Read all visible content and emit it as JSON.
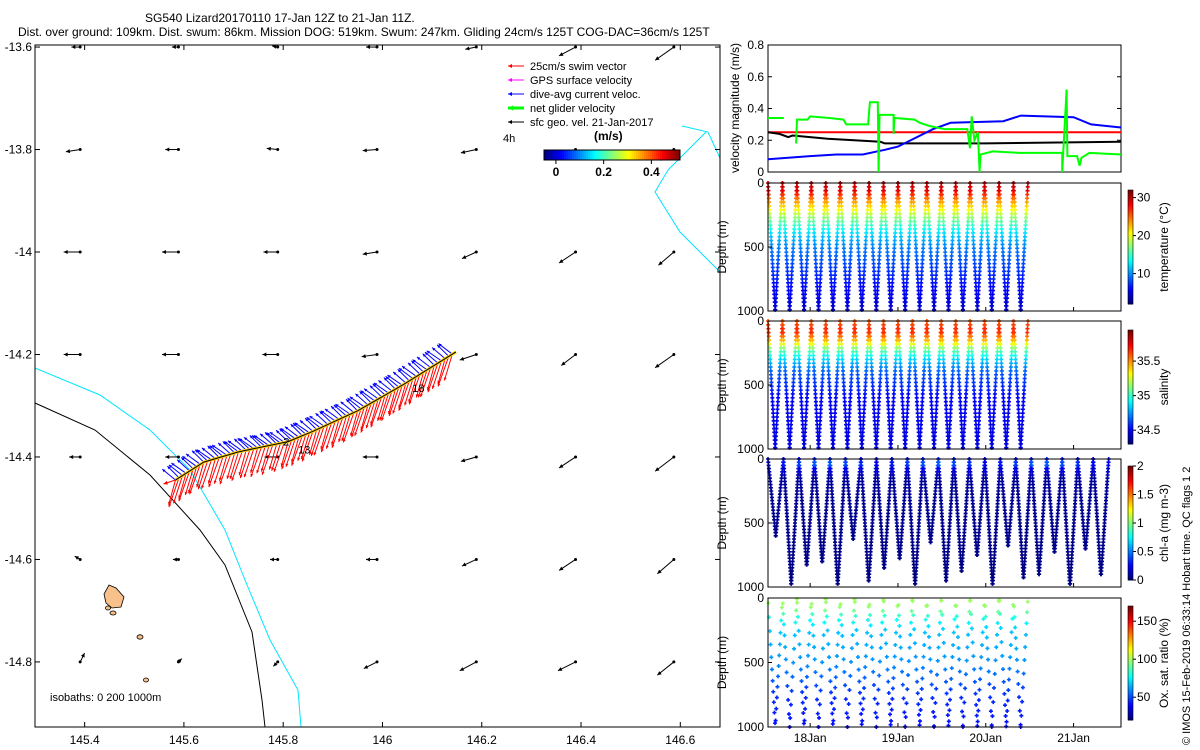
{
  "title": {
    "line1": "SG540 Lizard20170110 17-Jan 12Z to 21-Jan 11Z.",
    "line2": "Dist. over ground: 109km. Dist. swum: 86km. Mission DOG: 519km. Swum: 247km. Gliding 24cm/s 125T COG-DAC=36cm/s 125T"
  },
  "credit": "© IMOS 15-Feb-2019 06:33:14 Hobart time. QC flags 1  2",
  "chart_data": [
    {
      "type": "map",
      "name": "track-map",
      "xlim": [
        145.3,
        146.68
      ],
      "ylim": [
        -14.927,
        -13.596
      ],
      "xticks": [
        145.4,
        145.6,
        145.8,
        146,
        146.2,
        146.4,
        146.6
      ],
      "xtick_labels": [
        "145.4",
        "145.6",
        "145.8",
        "146",
        "146.2",
        "146.4",
        "146.6"
      ],
      "yticks": [
        -13.6,
        -13.8,
        -14,
        -14.2,
        -14.4,
        -14.6,
        -14.8
      ],
      "ytick_labels": [
        "-13.6",
        "-13.8",
        "-14",
        "-14.2",
        "-14.4",
        "-14.6",
        "-14.8"
      ],
      "legend": {
        "placement": "top-right",
        "entries": [
          {
            "label": "25cm/s swim vector",
            "color": "#ff0000"
          },
          {
            "label": "GPS surface velocity",
            "color": "#ff00ff"
          },
          {
            "label": "dive-avg current veloc.",
            "color": "#0000ff"
          },
          {
            "label": "net glider velocity",
            "color": "#00ff00"
          },
          {
            "label": "sfc geo. vel. 21-Jan-2017",
            "color": "#000000"
          }
        ],
        "interval_label": "4h"
      },
      "speed_colorbar": {
        "label": "(m/s)",
        "range": [
          -0.05,
          0.52
        ],
        "ticks": [
          0,
          0.2,
          0.4
        ],
        "tick_labels": [
          "0",
          "0.2",
          "0.4"
        ]
      },
      "isobath_label": "isobaths: 0   200  1000m",
      "vector_field": {
        "lons": [
          145.391,
          145.589,
          145.789,
          145.989,
          146.189,
          146.389,
          146.587
        ],
        "lats": [
          -13.6,
          -13.8,
          -14.0,
          -14.2,
          -14.4,
          -14.6,
          -14.8
        ],
        "uv": [
          [
            [
              -0.08,
              0
            ],
            [
              -0.06,
              0
            ],
            [
              -0.05,
              0.01
            ],
            [
              -0.1,
              0
            ],
            [
              -0.1,
              -0.02
            ],
            [
              -0.15,
              -0.08
            ],
            [
              -0.17,
              -0.12
            ]
          ],
          [
            [
              -0.13,
              -0.02
            ],
            [
              -0.12,
              0
            ],
            [
              -0.1,
              0.01
            ],
            [
              -0.13,
              -0.01
            ],
            [
              -0.14,
              -0.03
            ],
            [
              -0.15,
              -0.06
            ],
            [
              -0.12,
              -0.1
            ]
          ],
          [
            [
              -0.15,
              0
            ],
            [
              -0.15,
              0
            ],
            [
              -0.13,
              0
            ],
            [
              -0.13,
              -0.02
            ],
            [
              -0.13,
              -0.06
            ],
            [
              -0.15,
              -0.1
            ],
            [
              -0.14,
              -0.12
            ]
          ],
          [
            [
              -0.15,
              0
            ],
            [
              -0.15,
              0
            ],
            [
              -0.14,
              0
            ],
            [
              -0.14,
              -0.02
            ],
            [
              -0.15,
              -0.05
            ],
            [
              -0.13,
              -0.1
            ],
            [
              -0.17,
              -0.12
            ]
          ],
          [
            [
              -0.1,
              0
            ],
            [
              -0.12,
              0
            ],
            [
              -0.12,
              0
            ],
            [
              -0.13,
              0
            ],
            [
              -0.14,
              -0.04
            ],
            [
              -0.15,
              -0.1
            ],
            [
              -0.17,
              -0.13
            ]
          ],
          [
            [
              -0.05,
              0.03
            ],
            [
              -0.05,
              0
            ],
            [
              -0.07,
              0
            ],
            [
              -0.1,
              0
            ],
            [
              -0.13,
              -0.06
            ],
            [
              -0.15,
              -0.1
            ],
            [
              -0.15,
              -0.13
            ]
          ],
          [
            [
              0.04,
              0.08
            ],
            [
              0.03,
              0.03
            ],
            [
              -0.04,
              -0.04
            ],
            [
              -0.12,
              -0.06
            ],
            [
              -0.15,
              -0.08
            ],
            [
              -0.16,
              -0.08
            ],
            [
              -0.15,
              -0.12
            ]
          ]
        ]
      },
      "track": [
        [
          145.583,
          -14.445
        ],
        [
          145.64,
          -14.41
        ],
        [
          145.71,
          -14.39
        ],
        [
          145.81,
          -14.37
        ],
        [
          145.86,
          -14.35
        ],
        [
          145.95,
          -14.31
        ],
        [
          146.04,
          -14.26
        ],
        [
          146.09,
          -14.23
        ],
        [
          146.148,
          -14.195
        ]
      ],
      "track_labels": [
        {
          "text": "2",
          "lon": 145.8,
          "lat": -14.37
        },
        {
          "text": "13",
          "lon": 145.83,
          "lat": -14.385
        },
        {
          "text": "18",
          "lon": 146.06,
          "lat": -14.265
        }
      ],
      "current_vector": [
        -0.12,
        0.22
      ],
      "swim_vector": [
        -0.08,
        -0.25
      ]
    },
    {
      "type": "line",
      "name": "velocity-magnitude",
      "ylabel": "velocity magnitude (m/s)",
      "xlim": [
        17.52,
        21.54
      ],
      "ylim": [
        0,
        0.8
      ],
      "yticks": [
        0,
        0.2,
        0.4,
        0.6,
        0.8
      ],
      "ytick_labels": [
        "0",
        "0.2",
        "0.4",
        "0.6",
        "0.8"
      ],
      "series": [
        {
          "name": "swim",
          "color": "#ff0000",
          "x": [
            17.52,
            21.54
          ],
          "y": [
            0.25,
            0.25
          ]
        },
        {
          "name": "sfc geo",
          "color": "#000000",
          "x": [
            17.52,
            17.65,
            17.75,
            17.8,
            18.2,
            18.5,
            18.8,
            18.85,
            19.0,
            19.5,
            20.0,
            21.54
          ],
          "y": [
            0.25,
            0.24,
            0.22,
            0.23,
            0.21,
            0.2,
            0.19,
            0.18,
            0.18,
            0.18,
            0.18,
            0.19
          ]
        },
        {
          "name": "dive-avg current",
          "color": "#0000ff",
          "x": [
            17.52,
            18.0,
            18.3,
            18.6,
            18.85,
            19.0,
            19.4,
            19.6,
            20.2,
            20.4,
            21.0,
            21.2,
            21.54
          ],
          "y": [
            0.08,
            0.1,
            0.11,
            0.11,
            0.14,
            0.16,
            0.27,
            0.31,
            0.32,
            0.355,
            0.345,
            0.3,
            0.28
          ]
        },
        {
          "name": "net glider",
          "color": "#00ff00",
          "x": [
            17.52,
            17.7,
            null,
            17.84,
            17.85,
            17.97,
            18.0,
            18.22,
            18.38,
            18.41,
            18.66,
            18.68,
            18.77,
            18.78,
            18.79,
            18.95,
            18.95,
            18.96,
            19.19,
            19.25,
            19.36,
            19.53,
            19.79,
            19.82,
            19.84,
            19.87,
            19.91,
            19.93,
            19.94,
            20.08,
            20.38,
            20.87,
            20.87,
            20.92,
            20.93,
            21.04,
            21.07,
            21.09,
            21.18,
            21.54
          ],
          "y": [
            0.34,
            0.34,
            null,
            0.18,
            0.33,
            0.33,
            0.35,
            0.34,
            0.33,
            0.3,
            0.3,
            0.44,
            0.44,
            0,
            0.36,
            0.36,
            0.24,
            0.34,
            0.33,
            0.31,
            0.29,
            0.27,
            0.27,
            0.15,
            0.35,
            0.2,
            0.25,
            0,
            0.11,
            0.13,
            0.12,
            0.12,
            0,
            0.52,
            0.1,
            0.1,
            0.04,
            0.09,
            0.12,
            0.11
          ]
        }
      ]
    },
    {
      "type": "scatter",
      "name": "temperature-section",
      "variable": "temperature",
      "ylabel": "Depth (m)",
      "clabel": "temperature (°C)",
      "ylim": [
        1000,
        0
      ],
      "clim": [
        2,
        32
      ],
      "cticks": [
        10,
        20,
        30
      ],
      "ctick_labels": [
        "10",
        "20",
        "30"
      ],
      "dives": {
        "start": 17.52,
        "end": 20.48,
        "count": 18,
        "max_depth": 1000,
        "sample_m": 30
      },
      "profile": [
        [
          0,
          30
        ],
        [
          60,
          29
        ],
        [
          120,
          25
        ],
        [
          200,
          21
        ],
        [
          300,
          16
        ],
        [
          400,
          12
        ],
        [
          500,
          9.5
        ],
        [
          700,
          7
        ],
        [
          1000,
          4
        ]
      ]
    },
    {
      "type": "scatter",
      "name": "salinity-section",
      "variable": "salinity",
      "ylabel": "Depth (m)",
      "clabel": "salinity",
      "ylim": [
        1000,
        0
      ],
      "clim": [
        34.3,
        35.95
      ],
      "cticks": [
        34.5,
        35,
        35.5
      ],
      "ctick_labels": [
        "34.5",
        "35",
        "35.5"
      ],
      "dives": {
        "start": 17.52,
        "end": 20.48,
        "count": 18,
        "max_depth": 1000,
        "sample_m": 30
      },
      "profile": [
        [
          0,
          35.6
        ],
        [
          80,
          35.7
        ],
        [
          150,
          35.45
        ],
        [
          220,
          35.1
        ],
        [
          300,
          34.85
        ],
        [
          400,
          34.65
        ],
        [
          600,
          34.5
        ],
        [
          1000,
          34.45
        ]
      ]
    },
    {
      "type": "scatter",
      "name": "chlorophyll-section",
      "variable": "chl-a",
      "ylabel": "Depth (m)",
      "clabel": "chl-a (mg m-3)",
      "ylim": [
        1000,
        0
      ],
      "clim": [
        0,
        2
      ],
      "cticks": [
        0,
        0.5,
        1,
        1.5,
        2
      ],
      "ctick_labels": [
        "0",
        "0.5",
        "1",
        "1.5",
        "2"
      ],
      "dives": {
        "start": 17.52,
        "end": 21.4,
        "count": 22,
        "max_depth": 1000,
        "sample_m": 25
      },
      "profile": [
        [
          0,
          0.3
        ],
        [
          40,
          0.5
        ],
        [
          80,
          0.2
        ],
        [
          150,
          0.05
        ],
        [
          1000,
          0
        ]
      ]
    },
    {
      "type": "scatter",
      "name": "oxygen-section",
      "variable": "oxygen saturation",
      "ylabel": "Depth (m)",
      "clabel": "Ox. sat. ratio (%)",
      "ylim": [
        1000,
        0
      ],
      "clim": [
        20,
        170
      ],
      "cticks": [
        50,
        100,
        150
      ],
      "ctick_labels": [
        "50",
        "100",
        "150"
      ],
      "dives": {
        "start": 17.52,
        "end": 20.48,
        "count": 18,
        "max_depth": 1000,
        "sample_m": 95
      },
      "profile": [
        [
          0,
          100
        ],
        [
          80,
          98
        ],
        [
          150,
          80
        ],
        [
          250,
          68
        ],
        [
          500,
          60
        ],
        [
          750,
          45
        ],
        [
          1000,
          40
        ]
      ],
      "xlim": [
        17.52,
        21.54
      ],
      "xticks": [
        18,
        19,
        20,
        21
      ],
      "xtick_labels": [
        "18Jan",
        "19Jan",
        "20Jan",
        "21Jan"
      ],
      "yticks": [
        0,
        500,
        1000
      ],
      "ytick_labels": [
        "0",
        "500",
        "1000"
      ]
    }
  ]
}
